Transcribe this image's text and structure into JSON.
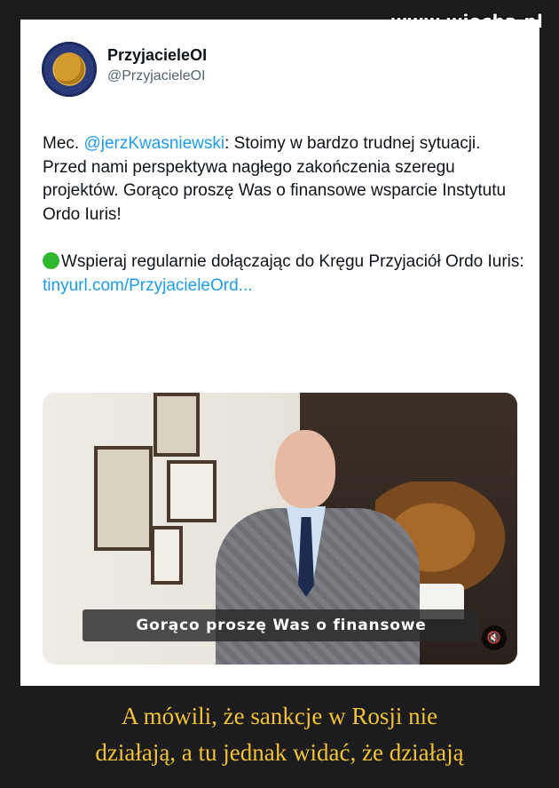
{
  "site": {
    "watermark": "www.wiocha.pl"
  },
  "tweet": {
    "display_name": "PrzyjacieleOI",
    "handle": "@PrzyjacieleOI",
    "paragraph1": {
      "prefix": "Mec. ",
      "mention": "@jerzKwasniewski",
      "text": ":  Stoimy w bardzo trudnej sytuacji. Przed nami perspektywa nagłego zakończenia szeregu projektów. Gorąco proszę Was o finansowe wsparcie Instytutu Ordo Iuris!"
    },
    "paragraph2": {
      "text": "Wspieraj regularnie dołączając do Kręgu Przyjaciół Ordo Iuris: ",
      "link": "tinyurl.com/PrzyjacieleOrd..."
    },
    "video": {
      "caption": "Gorąco proszę Was o finansowe",
      "mute_icon": "speaker-muted-icon"
    }
  },
  "bottom_caption": {
    "line1": "A mówili, że sankcje w Rosji nie",
    "line2": "działają, a tu jednak widać, że działają"
  },
  "colors": {
    "background": "#1c1c1e",
    "link": "#1d9bf0",
    "caption_text": "#f2c232"
  }
}
